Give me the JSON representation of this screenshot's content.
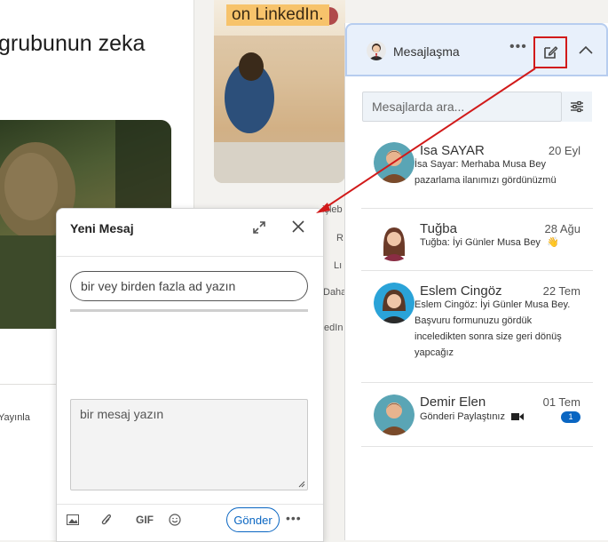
{
  "feed_post": {
    "text": "grubunun zeka",
    "publish_label": "Yayınla"
  },
  "ad": {
    "banner": "on LinkedIn.",
    "side_items": [
      "işleb",
      "R",
      "Lı",
      "Daha",
      "tedIn"
    ]
  },
  "messaging": {
    "title": "Mesajlaşma",
    "more_label": "•••",
    "search": {
      "placeholder": "Mesajlarda ara..."
    },
    "conversations": [
      {
        "name": "İsa SAYAR",
        "date": "20 Eyl",
        "snippet": "İsa Sayar: Merhaba Musa Bey pazarlama ilanımızı gördünüzmü",
        "avatar": "male-avatar"
      },
      {
        "name": "Tuğba",
        "date": "28 Ağu",
        "snippet": "Tuğba: İyi Günler Musa Bey",
        "emoji": "👋",
        "avatar": "female-avatar"
      },
      {
        "name": "Eslem Cingöz",
        "date": "22 Tem",
        "snippet": "Eslem Cingöz: İyi Günler Musa Bey. Başvuru formunuzu gördük inceledikten sonra size geri dönüş yapcağız",
        "avatar": "female-avatar"
      },
      {
        "name": "Demir Elen",
        "date": "01 Tem",
        "snippet": "Gönderi Paylaştınız",
        "unread": "1",
        "avatar": "male-avatar"
      }
    ]
  },
  "new_message": {
    "title": "Yeni Mesaj",
    "to_placeholder": "bir vey birden fazla ad yazın",
    "body_placeholder": "bir mesaj yazın",
    "gif_label": "GIF",
    "send_label": "Gönder",
    "more_label": "•••"
  },
  "colors": {
    "accent": "#0a66c2",
    "highlight": "#d11a1a",
    "header_bg": "#e8f0fb"
  }
}
